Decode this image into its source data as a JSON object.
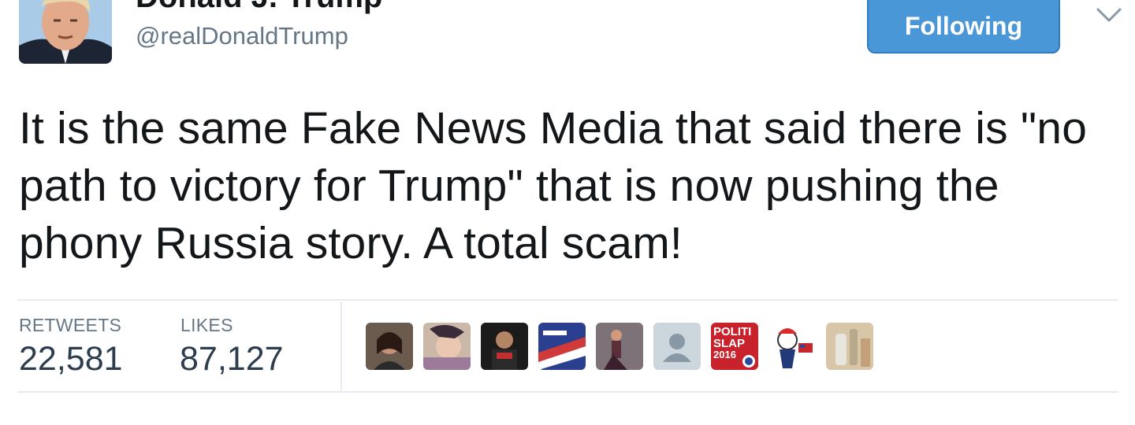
{
  "profile": {
    "display_name": "Donald J. Trump",
    "handle": "@realDonaldTrump",
    "verified_icon": "verified-badge-icon"
  },
  "follow_button": {
    "label": "Following"
  },
  "menu_caret": {
    "icon": "chevron-down-icon"
  },
  "tweet": {
    "text": "It is the same Fake News Media that said there is \"no path to victory for Trump\" that is now pushing the phony Russia story. A total scam!"
  },
  "stats": {
    "retweets_label": "RETWEETS",
    "retweets_count": "22,581",
    "likes_label": "LIKES",
    "likes_count": "87,127"
  },
  "likers": [
    {
      "name": "liker-avatar-1"
    },
    {
      "name": "liker-avatar-2"
    },
    {
      "name": "liker-avatar-3"
    },
    {
      "name": "liker-avatar-4"
    },
    {
      "name": "liker-avatar-5"
    },
    {
      "name": "liker-avatar-default"
    },
    {
      "name": "liker-avatar-politi-slap",
      "text": [
        "POLITI",
        "SLAP",
        "2016"
      ]
    },
    {
      "name": "liker-avatar-8"
    },
    {
      "name": "liker-avatar-9"
    }
  ],
  "colors": {
    "follow_button_bg": "#4a97d8",
    "text": "#14171a",
    "secondary_text": "#657786",
    "verified": "#5ea8e5"
  }
}
